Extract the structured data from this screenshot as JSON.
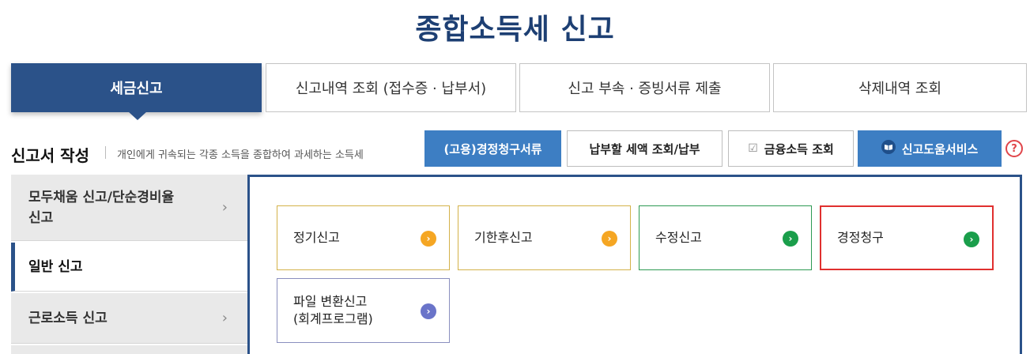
{
  "page_title": "종합소득세 신고",
  "main_tabs": [
    {
      "label": "세금신고"
    },
    {
      "label": "신고내역 조회 (접수증 · 납부서)"
    },
    {
      "label": "신고 부속 · 증빙서류 제출"
    },
    {
      "label": "삭제내역 조회"
    }
  ],
  "section": {
    "title": "신고서 작성",
    "description": "개인에게 귀속되는 각종 소득을 종합하여 과세하는 소득세"
  },
  "actions": [
    {
      "label": "(고용)경정청구서류"
    },
    {
      "label": "납부할 세액 조회/납부"
    },
    {
      "label": "금융소득 조회",
      "icon": "checkbox-icon"
    },
    {
      "label": "신고도움서비스",
      "icon": "book-icon"
    }
  ],
  "help_label": "?",
  "sidebar": {
    "items": [
      {
        "label": "모두채움 신고/단순경비율\n신고"
      },
      {
        "label": "일반 신고"
      },
      {
        "label": "근로소득 신고"
      }
    ]
  },
  "cards": [
    {
      "label": "정기신고"
    },
    {
      "label": "기한후신고"
    },
    {
      "label": "수정신고"
    },
    {
      "label": "경정청구"
    },
    {
      "label": "파일 변환신고\n(회계프로그램)"
    }
  ],
  "colors": {
    "primary": "#2b5289",
    "title": "#1d3f73",
    "action_blue": "#3d7ec3",
    "card_yellow_border": "#d4b24a",
    "card_green_border": "#2e9a53",
    "card_highlight_border": "#e0302f",
    "card_purple_border": "#8a8fbf",
    "go_orange": "#f5a623",
    "go_green": "#1a9e4b",
    "go_purple": "#6a74c9"
  }
}
